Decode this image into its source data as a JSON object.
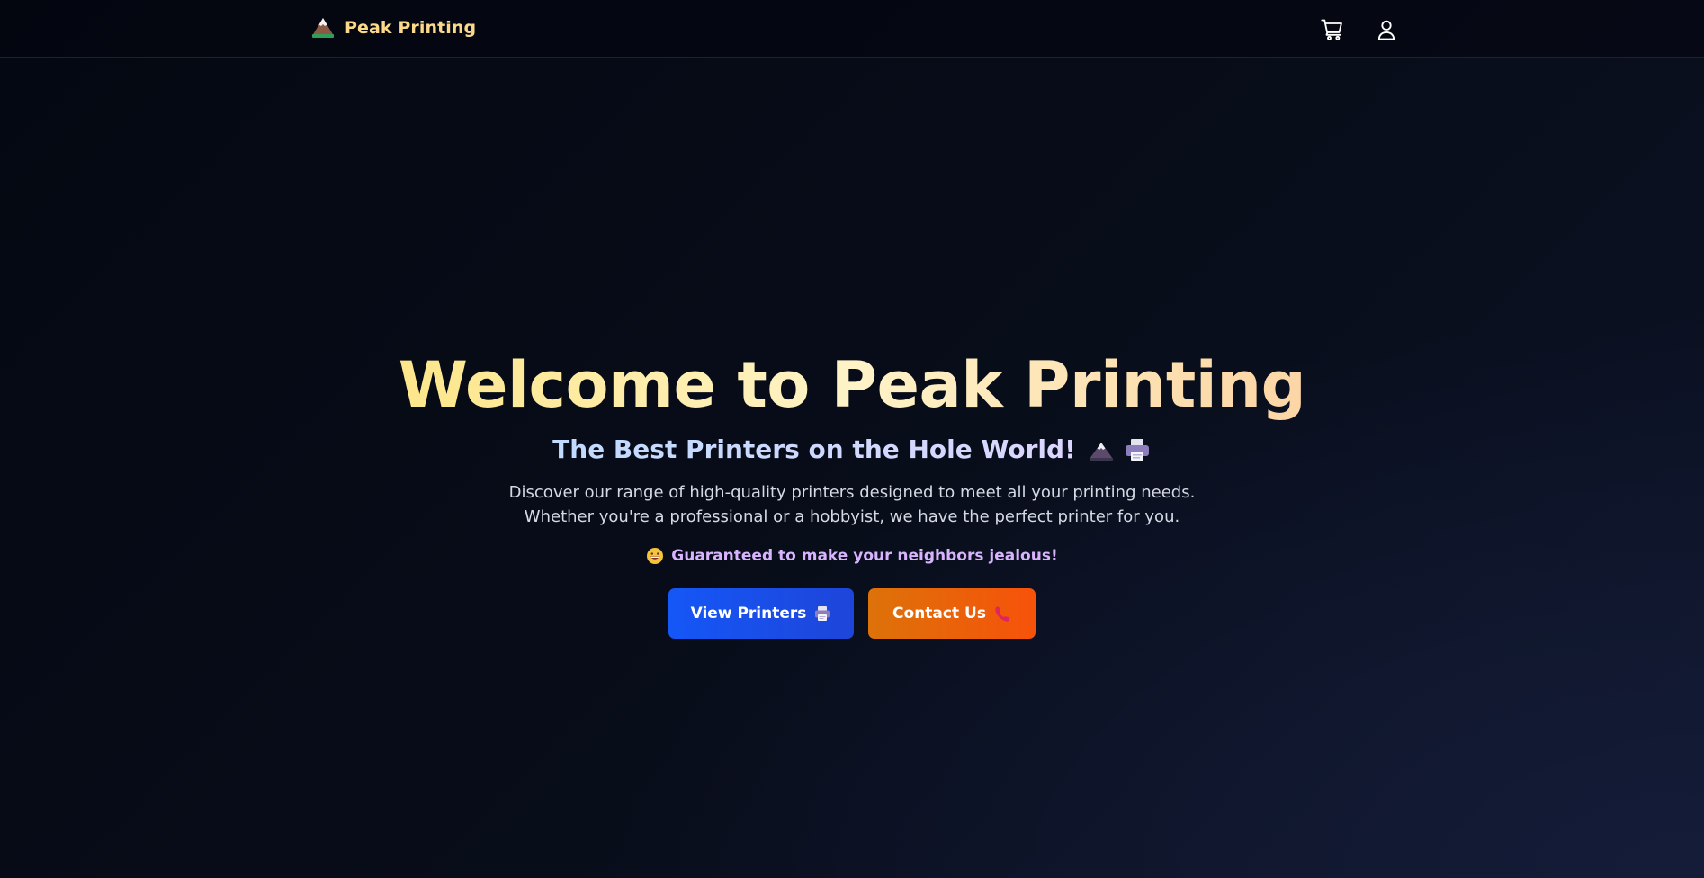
{
  "brand": {
    "name": "Peak Printing",
    "logo_icon": "mountain-icon"
  },
  "navbar": {
    "icons": [
      "cart-icon",
      "user-icon"
    ]
  },
  "hero": {
    "title": "Welcome to Peak Printing",
    "subtitle": "The Best Printers on the Hole World!",
    "subtitle_icons": [
      "mountain-icon",
      "printer-icon"
    ],
    "description_line1": "Discover our range of high-quality printers designed to meet all your printing needs.",
    "description_line2": "Whether you're a professional or a hobbyist, we have the perfect printer for you.",
    "tagline": "Guaranteed to make your neighbors jealous!",
    "tagline_icon": "grinning-face-icon"
  },
  "cta": {
    "primary_label": "View Printers",
    "primary_icon": "printer-icon",
    "secondary_label": "Contact Us",
    "secondary_icon": "phone-icon"
  },
  "colors": {
    "brand_gold": "#fcd98a",
    "primary_blue": "#1557f7",
    "secondary_orange": "#f7520a",
    "tagline_purple": "#d8b4fe"
  }
}
